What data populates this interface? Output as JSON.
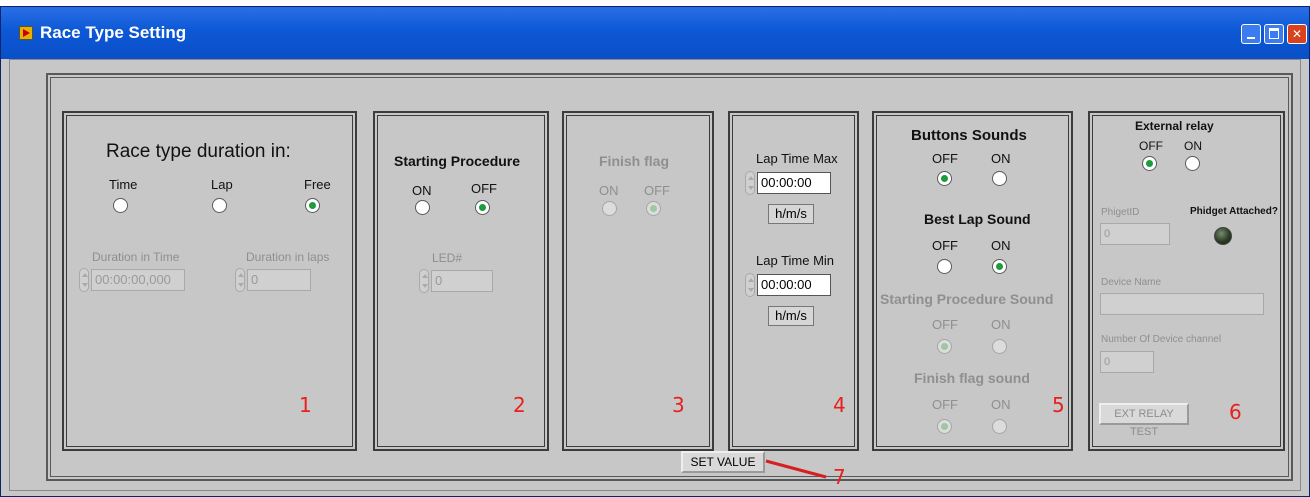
{
  "window": {
    "title": "Race Type Setting",
    "controls": {
      "minimize": "minimize-icon",
      "maximize": "maximize-icon",
      "close": "close-icon"
    }
  },
  "panel1": {
    "heading": "Race type duration in:",
    "options": [
      "Time",
      "Lap",
      "Free"
    ],
    "selected": "Free",
    "duration_time_label": "Duration in Time",
    "duration_time_value": "00:00:00,000",
    "duration_laps_label": "Duration in laps",
    "duration_laps_value": "0",
    "number": "1"
  },
  "panel2": {
    "heading": "Starting Procedure",
    "on": "ON",
    "off": "OFF",
    "selected": "OFF",
    "led_label": "LED#",
    "led_value": "0",
    "number": "2"
  },
  "panel3": {
    "heading": "Finish flag",
    "on": "ON",
    "off": "OFF",
    "selected": "OFF",
    "number": "3"
  },
  "panel4": {
    "max_label": "Lap Time Max",
    "max_value": "00:00:00",
    "max_unit": "h/m/s",
    "min_label": "Lap Time Min",
    "min_value": "00:00:00",
    "min_unit": "h/m/s",
    "number": "4"
  },
  "panel5": {
    "buttons_sounds": "Buttons Sounds",
    "best_lap_sound": "Best Lap Sound",
    "starting_procedure_sound": "Starting Procedure Sound",
    "finish_flag_sound": "Finish flag sound",
    "off": "OFF",
    "on": "ON",
    "number": "5"
  },
  "panel6": {
    "heading": "External relay",
    "off": "OFF",
    "on": "ON",
    "phidget_id_label": "PhigetID",
    "phidget_id_value": "0",
    "attached_label": "Phidget Attached?",
    "device_name_label": "Device Name",
    "device_name_value": "",
    "channel_label": "Number Of Device channel",
    "channel_value": "0",
    "test_button": "EXT RELAY TEST",
    "number": "6"
  },
  "set_value_button": "SET VALUE",
  "set_value_number": "7",
  "colors": {
    "title_bar": "#0a4fc8",
    "annotation": "#e8201e",
    "radio_selected": "#1e9b3a",
    "panel_bg": "#c7c7c7"
  }
}
